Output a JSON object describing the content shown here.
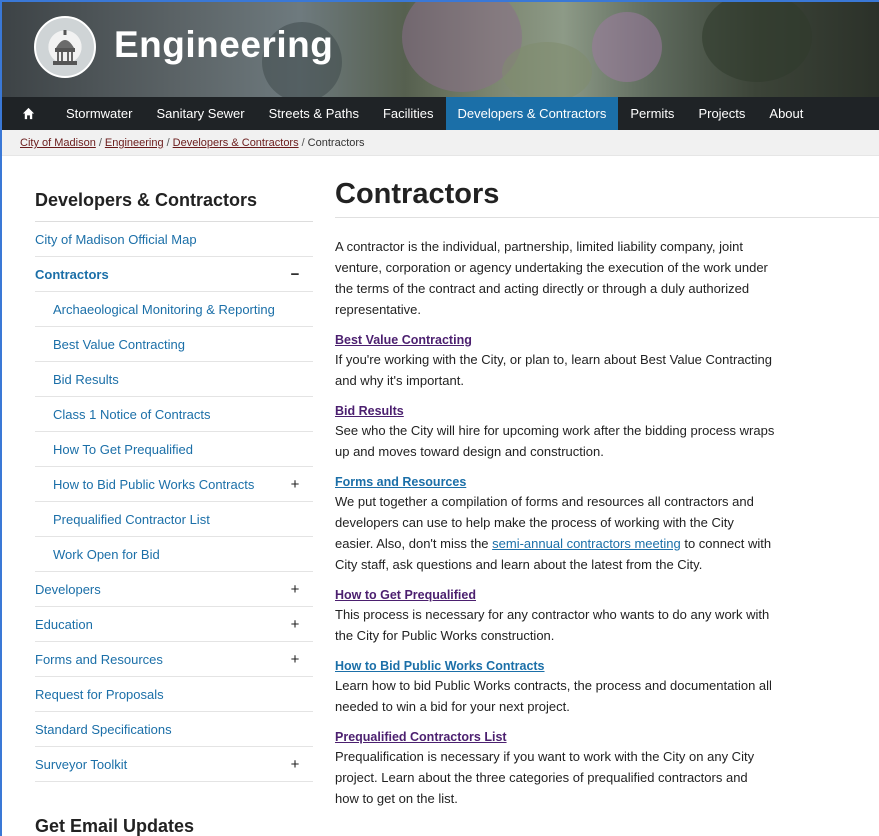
{
  "header": {
    "brand": "Engineering",
    "seal_alt": "City of Madison Engineering seal"
  },
  "nav": {
    "home_icon": "home-icon",
    "items": [
      {
        "label": "Stormwater",
        "active": false
      },
      {
        "label": "Sanitary Sewer",
        "active": false
      },
      {
        "label": "Streets & Paths",
        "active": false
      },
      {
        "label": "Facilities",
        "active": false
      },
      {
        "label": "Developers & Contractors",
        "active": true
      },
      {
        "label": "Permits",
        "active": false
      },
      {
        "label": "Projects",
        "active": false
      },
      {
        "label": "About",
        "active": false
      }
    ]
  },
  "breadcrumb": {
    "crumbs": [
      "City of Madison",
      "Engineering",
      "Developers & Contractors"
    ],
    "current": "Contractors"
  },
  "sidebar": {
    "title": "Developers & Contractors",
    "items": [
      {
        "label": "City of Madison Official Map",
        "toggle": ""
      },
      {
        "label": "Contractors",
        "toggle": "−"
      },
      {
        "label": "Archaeological Monitoring & Reporting",
        "toggle": ""
      },
      {
        "label": "Best Value Contracting",
        "toggle": ""
      },
      {
        "label": "Bid Results",
        "toggle": ""
      },
      {
        "label": "Class 1 Notice of Contracts",
        "toggle": ""
      },
      {
        "label": "How To Get Prequalified",
        "toggle": ""
      },
      {
        "label": "How to Bid Public Works Contracts",
        "toggle": "+"
      },
      {
        "label": "Prequalified Contractor List",
        "toggle": ""
      },
      {
        "label": "Work Open for Bid",
        "toggle": ""
      },
      {
        "label": "Developers",
        "toggle": "+"
      },
      {
        "label": "Education",
        "toggle": "+"
      },
      {
        "label": "Forms and Resources",
        "toggle": "+"
      },
      {
        "label": "Request for Proposals",
        "toggle": ""
      },
      {
        "label": "Standard Specifications",
        "toggle": ""
      },
      {
        "label": "Surveyor Toolkit",
        "toggle": "+"
      }
    ],
    "email_title": "Get Email Updates"
  },
  "main": {
    "title": "Contractors",
    "intro": "A contractor is the individual, partnership, limited liability company, joint venture, corporation or agency undertaking the execution of the work under the terms of the contract and acting directly or through a duly authorized representative.",
    "entries": [
      {
        "link": "Best Value Contracting",
        "text": "If you're working with the City, or plan to, learn about Best Value Contracting and why it's important."
      },
      {
        "link": "Bid Results",
        "text": "See who the City will hire for upcoming work after the bidding process wraps up and moves toward design and construction."
      },
      {
        "link": "Forms and Resources",
        "text": "We put together a compilation of forms and resources all contractors and developers can use to help make the process of working with the City easier.",
        "text_pre": "Also, don't miss the ",
        "inline_link": "semi-annual contractors meeting",
        "text_post": " to connect with City staff, ask questions and learn about the latest from the City."
      },
      {
        "link": "How to Get Prequalified",
        "text": "This process is necessary for any contractor who wants to do any work with the City for Public Works construction."
      },
      {
        "link": "How to Bid Public Works Contracts",
        "text": "Learn how to bid Public Works contracts, the process and documentation all needed to win a bid for your next project."
      },
      {
        "link": "Prequalified Contractors List",
        "text": "Prequalification is necessary if you want to work with the City on any City project. Learn about the three categories of prequalified contractors and how to get on the list."
      }
    ]
  },
  "colors": {
    "nav_bg": "#1f2326",
    "nav_active": "#1b6fa8",
    "link_blue": "#1b6fa8",
    "link_visited": "#4b1f6f",
    "breadcrumb_link": "#6a1b1b"
  }
}
